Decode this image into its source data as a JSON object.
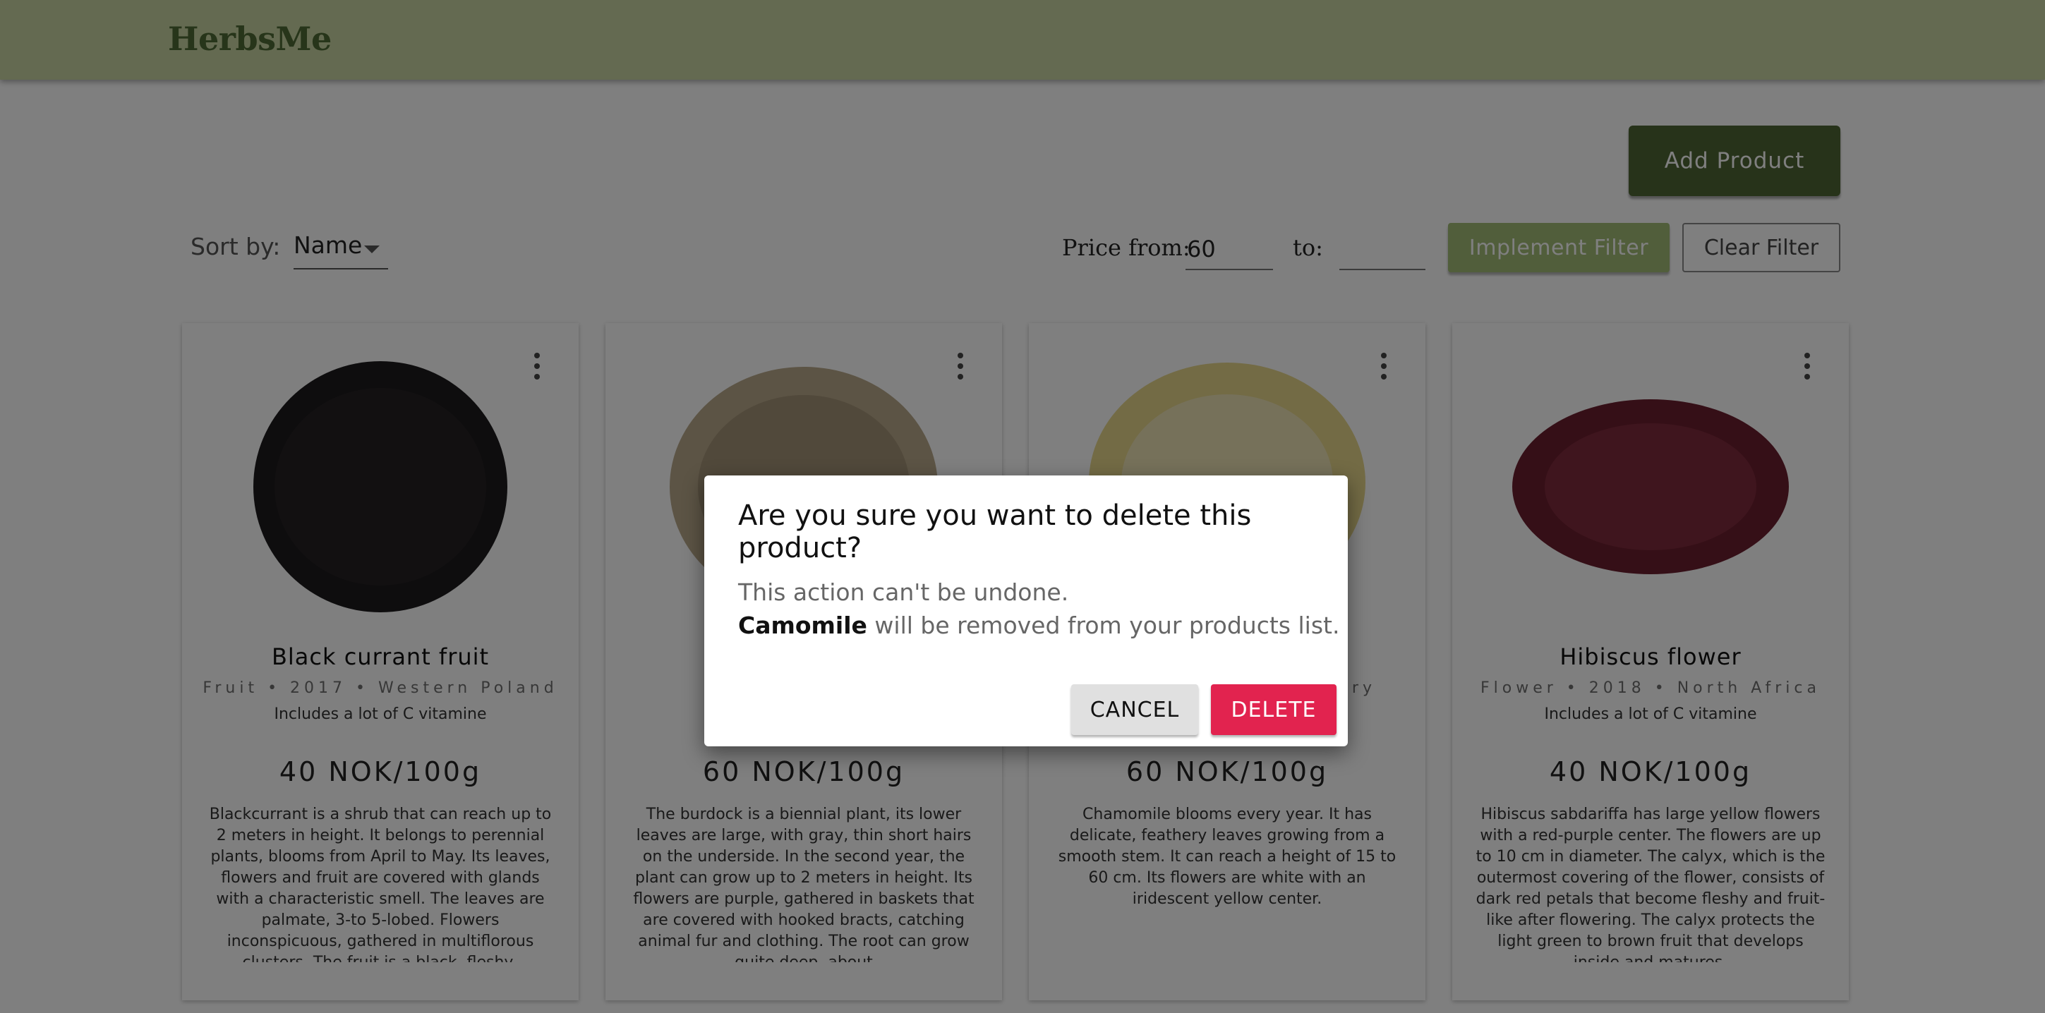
{
  "header": {
    "brand": "HerbsMe"
  },
  "toolbar": {
    "add_product_label": "Add Product",
    "sort_label": "Sort by:",
    "sort_value": "Name",
    "price_from_label": "Price from:",
    "price_from_value": "60",
    "price_to_label": "to:",
    "price_to_value": "",
    "implement_filter_label": "Implement Filter",
    "clear_filter_label": "Clear Filter"
  },
  "products": [
    {
      "name": "Black currant fruit",
      "meta": "Fruit • 2017 • Western Poland",
      "note": "Includes a lot of C vitamine",
      "price": "40 NOK/100g",
      "description": "Blackcurrant is a shrub that can reach up to 2 meters in height. It belongs to perennial plants, blooms from April to May. Its leaves, flowers and fruit are covered with glands with a characteristic smell. The leaves are palmate, 3-to 5-lobed. Flowers inconspicuous, gathered in multiflorous clusters. The fruit is a black, fleshy,",
      "image_color": "#1c1a1c"
    },
    {
      "name": "",
      "meta": "",
      "note": "",
      "price": "60 NOK/100g",
      "description": "The burdock is a biennial plant, its lower leaves are large, with gray, thin short hairs on the underside. In the second year, the plant can grow up to 2 meters in height. Its flowers are purple, gathered in baskets that are covered with hooked bracts, catching animal fur and clothing. The root can grow quite deep, about",
      "image_color": "#b9a88a"
    },
    {
      "name": "",
      "meta": "ary",
      "note": "",
      "price": "60 NOK/100g",
      "description": "Chamomile blooms every year. It has delicate, feathery leaves growing from a smooth stem. It can reach a height of 15 to 60 cm. Its flowers are white with an iridescent yellow center.",
      "image_color": "#e6d78a"
    },
    {
      "name": "Hibiscus flower",
      "meta": "Flower • 2018 • North Africa",
      "note": "Includes a lot of C vitamine",
      "price": "40 NOK/100g",
      "description": "Hibiscus sabdariffa has large yellow flowers with a red-purple center. The flowers are up to 10 cm in diameter. The calyx, which is the outermost covering of the flower, consists of dark red petals that become fleshy and fruit-like after flowering. The calyx protects the light green to brown fruit that develops inside and matures.",
      "image_color": "#6b1f2e"
    }
  ],
  "dialog": {
    "title": "Are you sure you want to delete this product?",
    "line1": "This action can't be undone.",
    "product_name": "Camomile",
    "line2_rest": " will be removed from your products list.",
    "cancel_label": "CANCEL",
    "delete_label": "DELETE"
  },
  "colors": {
    "header_bg": "#c8d5a2",
    "brand_text": "#4f6a34",
    "primary_button": "#4f6735",
    "filter_button": "#a3bd76",
    "delete_button": "#e2234f"
  }
}
